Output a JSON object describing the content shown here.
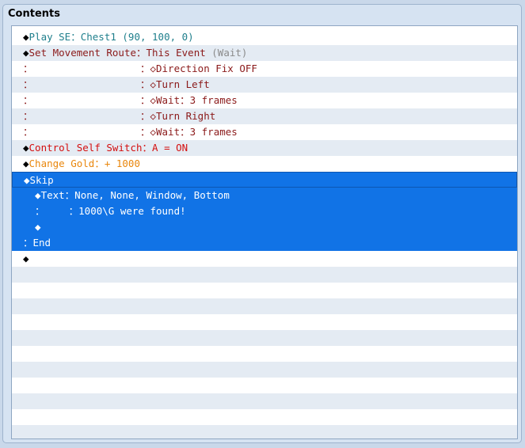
{
  "panel": {
    "title": "Contents"
  },
  "colors": {
    "selection": "#1173e6",
    "selection_border": "#0d57b2",
    "stripe": "#e4ebf3",
    "teal": "#1f7f8c",
    "maroon": "#8b1a1a",
    "gray": "#8a8a8a",
    "red": "#d40f0f",
    "orange": "#e9870d"
  },
  "rows": [
    {
      "selected": false,
      "segments": [
        {
          "text": "◆",
          "color": "black"
        },
        {
          "text": "Play SE：Chest1 (90, 100, 0)",
          "color": "teal"
        }
      ]
    },
    {
      "selected": false,
      "segments": [
        {
          "text": "◆",
          "color": "black"
        },
        {
          "text": "Set Movement Route：This Event ",
          "color": "maroon"
        },
        {
          "text": "(Wait)",
          "color": "gray"
        }
      ]
    },
    {
      "selected": false,
      "segments": [
        {
          "text": "：                  ：",
          "color": "maroon"
        },
        {
          "text": "◇Direction Fix OFF",
          "color": "maroon"
        }
      ]
    },
    {
      "selected": false,
      "segments": [
        {
          "text": "：                  ：",
          "color": "maroon"
        },
        {
          "text": "◇Turn Left",
          "color": "maroon"
        }
      ]
    },
    {
      "selected": false,
      "segments": [
        {
          "text": "：                  ：",
          "color": "maroon"
        },
        {
          "text": "◇Wait：3 frames",
          "color": "maroon"
        }
      ]
    },
    {
      "selected": false,
      "segments": [
        {
          "text": "：                  ：",
          "color": "maroon"
        },
        {
          "text": "◇Turn Right",
          "color": "maroon"
        }
      ]
    },
    {
      "selected": false,
      "segments": [
        {
          "text": "：                  ：",
          "color": "maroon"
        },
        {
          "text": "◇Wait：3 frames",
          "color": "maroon"
        }
      ]
    },
    {
      "selected": false,
      "segments": [
        {
          "text": "◆",
          "color": "black"
        },
        {
          "text": "Control Self Switch：A = ON",
          "color": "red"
        }
      ]
    },
    {
      "selected": false,
      "segments": [
        {
          "text": "◆",
          "color": "black"
        },
        {
          "text": "Change Gold：+ 1000",
          "color": "orange"
        }
      ]
    },
    {
      "selected": true,
      "segments": [
        {
          "text": "◆Skip",
          "color": "white"
        }
      ]
    },
    {
      "selected": true,
      "segments": [
        {
          "text": "  ◆Text：None, None, Window, Bottom",
          "color": "white"
        }
      ]
    },
    {
      "selected": true,
      "segments": [
        {
          "text": "  ：    ：1000\\G were found!",
          "color": "white"
        }
      ]
    },
    {
      "selected": true,
      "segments": [
        {
          "text": "  ◆",
          "color": "white"
        }
      ]
    },
    {
      "selected": true,
      "segments": [
        {
          "text": "：End",
          "color": "white"
        }
      ]
    },
    {
      "selected": false,
      "segments": [
        {
          "text": "◆",
          "color": "black"
        }
      ]
    }
  ],
  "empty_rows": 12
}
